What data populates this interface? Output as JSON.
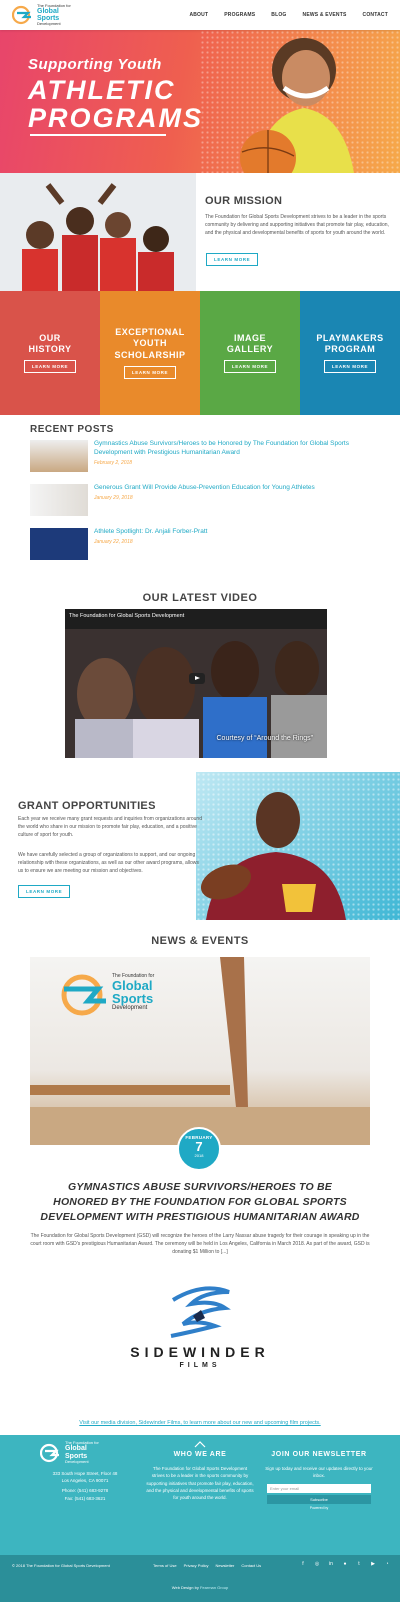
{
  "header": {
    "logo_small": "The Foundation for",
    "logo_main1": "Global",
    "logo_main2": "Sports",
    "logo_sub": "Development",
    "nav": [
      "ABOUT",
      "PROGRAMS",
      "BLOG",
      "NEWS & EVENTS",
      "CONTACT"
    ]
  },
  "hero": {
    "line1": "Supporting Youth",
    "line2a": "ATHLETIC",
    "line2b": "PROGRAMS"
  },
  "mission": {
    "title": "OUR MISSION",
    "text": "The Foundation for Global Sports Development strives to be a leader in the sports community by delivering and supporting initiatives that promote fair play, education, and the physical and developmental benefits of sports for youth around the world.",
    "button": "LEARN MORE"
  },
  "tiles": [
    {
      "title": "OUR HISTORY",
      "button": "LEARN MORE",
      "color": "#d9534a"
    },
    {
      "title": "EXCEPTIONAL YOUTH SCHOLARSHIP",
      "button": "LEARN MORE",
      "color": "#e98a2b"
    },
    {
      "title": "IMAGE GALLERY",
      "button": "LEARN MORE",
      "color": "#5aa845"
    },
    {
      "title": "PLAYMAKERS PROGRAM",
      "button": "LEARN MORE",
      "color": "#1a86b3"
    }
  ],
  "recent": {
    "title": "RECENT POSTS",
    "posts": [
      {
        "title": "Gymnastics Abuse Survivors/Heroes to be Honored by The Foundation for Global Sports Development with Prestigious Humanitarian Award",
        "date": "February 2, 2018"
      },
      {
        "title": "Generous Grant Will Provide Abuse-Prevention Education for Young Athletes",
        "date": "January 29, 2018"
      },
      {
        "title": "Athlete Spotlight: Dr. Anjali Forber-Pratt",
        "date": "January 22, 2018"
      }
    ]
  },
  "video": {
    "heading": "OUR LATEST VIDEO",
    "title": "The Foundation for Global Sports Development",
    "caption": "Courtesy of “Around the Rings”"
  },
  "grant": {
    "title": "GRANT OPPORTUNITIES",
    "p1": "Each year we receive many grant requests and inquiries from organizations around the world who share in our mission to promote fair play, education, and a positive culture of sport for youth.",
    "p2": "We have carefully selected a group of organizations to support, and our ongoing relationship with these organizations, as well as our other award programs, allows us to ensure we are meeting our mission and objectives.",
    "button": "LEARN MORE"
  },
  "news": {
    "heading": "NEWS & EVENTS",
    "logo_line1": "The Foundation for",
    "logo_line2": "Global",
    "logo_line3": "Sports",
    "logo_line4": "Development",
    "month": "FEBRUARY",
    "day": "7",
    "year": "2018",
    "headline": "GYMNASTICS ABUSE SURVIVORS/HEROES TO BE HONORED BY THE FOUNDATION FOR GLOBAL SPORTS DEVELOPMENT WITH PRESTIGIOUS HUMANITARIAN AWARD",
    "body": "The Foundation for Global Sports Development (GSD) will recognize the heroes of the Larry Nassar abuse tragedy for their courage in speaking up in the court room with GSD's prestigious Humanitarian Award. The ceremony will be held in Los Angeles, California in March 2018. As part of the award, GSD is donating $1 Million to [...]"
  },
  "sidewinder": {
    "name": "SIDEWINDER",
    "sub": "FILMS",
    "link": "Visit our media division, Sidewinder Films, to learn more about our new and upcoming film projects."
  },
  "footer": {
    "logo_main1": "Global",
    "logo_main2": "Sports",
    "logo_sub": "Development",
    "logo_small": "The Foundation for",
    "address1": "333 South Hope Street, Floor 48",
    "address2": "Los Angeles, CA 90071",
    "phone": "Phone: (541) 683-9278",
    "fax": "Fax: (541) 683-3621",
    "who_title": "WHO WE ARE",
    "who_text": "The Foundation for Global Sports Development strives to be a leader in the sports community by supporting initiatives that promote fair play, education, and the physical and developmental benefits of sports for youth around the world.",
    "news_title": "JOIN OUR NEWSLETTER",
    "news_text": "Sign up today and receive our updates directly to your inbox.",
    "email_placeholder": "Enter your email",
    "subscribe": "Subscribe",
    "powered": "Powered by",
    "copyright": "© 2018 The Foundation for Global Sports Development",
    "links": [
      "Terms of Use",
      "Privacy Policy",
      "Newsletter",
      "Contact Us"
    ],
    "webdesign": "Web Design by",
    "webdesign_link": "Fearman Group"
  }
}
